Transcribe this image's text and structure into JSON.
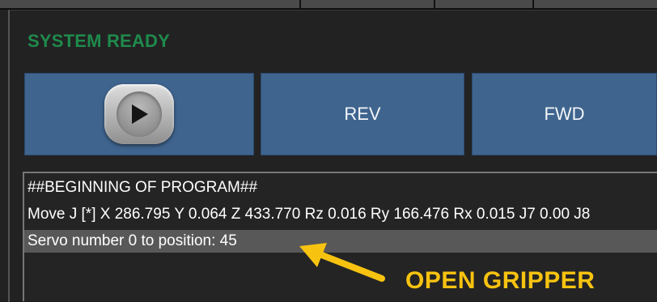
{
  "status": {
    "text": "SYSTEM READY",
    "color": "#1f8a4c"
  },
  "controls": {
    "play_icon": "play-icon",
    "rev_label": "REV",
    "fwd_label": "FWD",
    "button_color": "#3f648e"
  },
  "program": {
    "lines": [
      "##BEGINNING OF PROGRAM##",
      "Move J [*] X 286.795 Y 0.064 Z 433.770 Rz 0.016 Ry 166.476 Rx 0.015 J7 0.00 J8",
      "Servo number 0 to position: 45"
    ],
    "selected_index": 2
  },
  "annotation": {
    "text": "OPEN GRIPPER",
    "color": "#f7c310",
    "icon": "arrow-icon"
  }
}
